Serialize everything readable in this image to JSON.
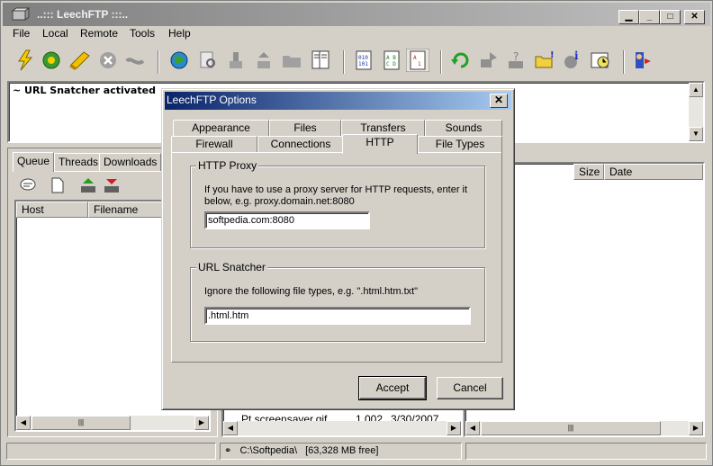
{
  "window": {
    "title": "..::: LeechFTP :::.."
  },
  "menubar": {
    "items": [
      "File",
      "Local",
      "Remote",
      "Tools",
      "Help"
    ]
  },
  "log": {
    "text": "~ URL Snatcher activated"
  },
  "left_panel": {
    "tabs": [
      "Queue",
      "Threads",
      "Downloads"
    ],
    "columns": [
      "Host",
      "Filename"
    ]
  },
  "right_panel": {
    "columns": [
      "Size",
      "Date"
    ]
  },
  "mid_panel": {
    "visible_file": {
      "name": "Pt screensaver.gif",
      "size": "1,002",
      "date": "3/30/2007"
    }
  },
  "statusbar": {
    "path": "C:\\Softpedia\\",
    "free": "[63,328 MB free]"
  },
  "dialog": {
    "title": "LeechFTP Options",
    "tabs_row1": [
      "Appearance",
      "Files",
      "Transfers",
      "Sounds"
    ],
    "tabs_row2": [
      "Firewall",
      "Connections",
      "HTTP",
      "File Types"
    ],
    "active_tab": "HTTP",
    "proxy_group": {
      "title": "HTTP Proxy",
      "description": "If you have to use a proxy server for HTTP requests, enter it below, e.g. proxy.domain.net:8080",
      "value": "softpedia.com:8080"
    },
    "snatcher_group": {
      "title": "URL Snatcher",
      "description": "Ignore the following file types, e.g. \".html.htm.txt\"",
      "value": ".html.htm"
    },
    "ok_label": "Accept",
    "cancel_label": "Cancel"
  },
  "toolbar": {
    "icons": [
      "lightning-icon",
      "connect-globe-icon",
      "bookmark-icon",
      "stop-icon",
      "disconnect-icon",
      "globe-icon",
      "search-file-icon",
      "upload-icon",
      "download-icon",
      "folder-icon",
      "view-file-icon",
      "binary-mode-icon",
      "ascii-mode-icon",
      "auto-mode-icon",
      "refresh-icon",
      "transfer-icon",
      "help-transfer-icon",
      "new-folder-icon",
      "info-icon",
      "schedule-icon",
      "exit-icon"
    ]
  },
  "colors": {
    "dialog_title_start": "#0a246a",
    "dialog_title_end": "#a6caf0",
    "face": "#d4d0c8"
  }
}
